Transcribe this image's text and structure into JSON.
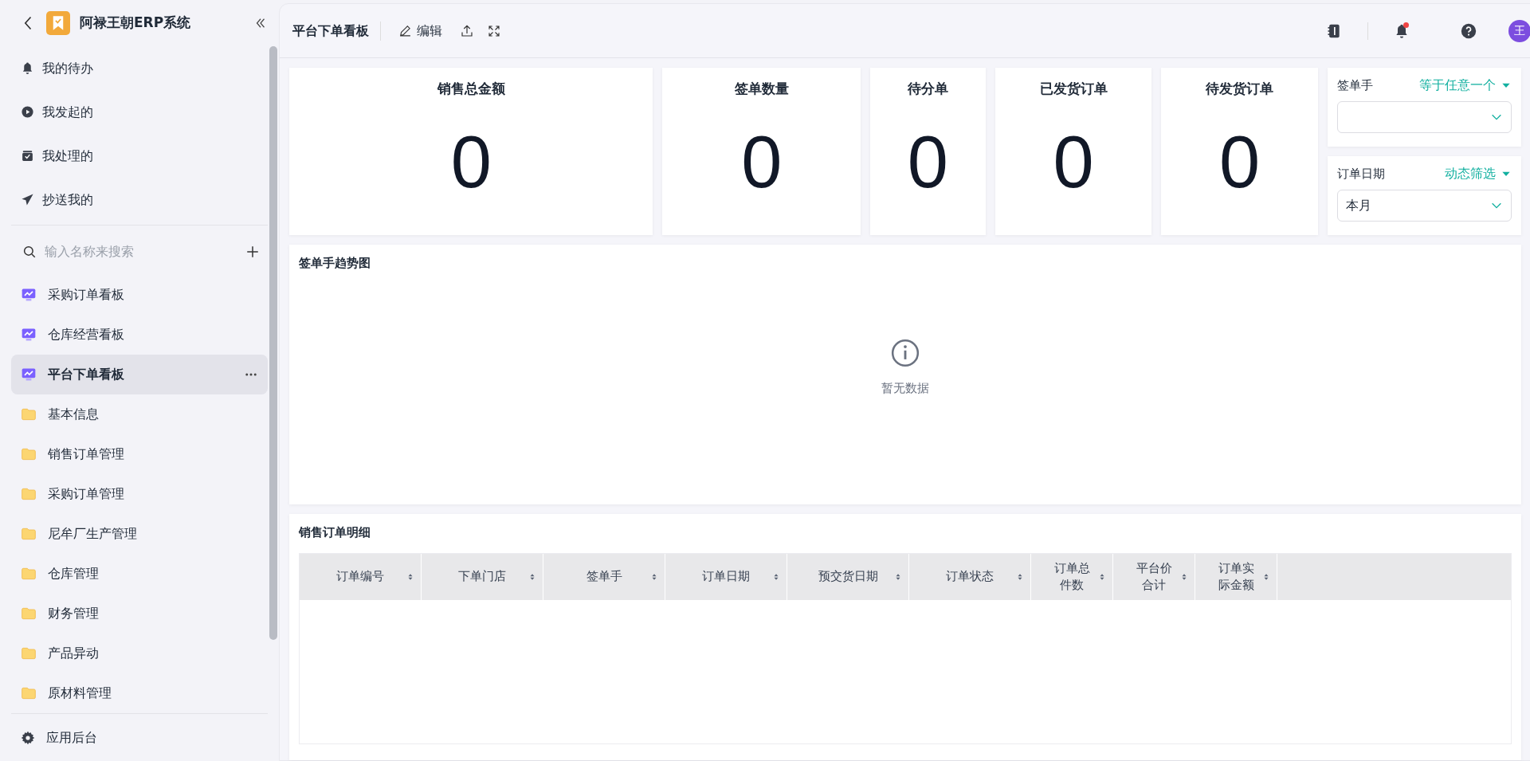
{
  "app": {
    "title": "阿禄王朝ERP系统"
  },
  "sidebar": {
    "nav": [
      {
        "label": "我的待办",
        "kind": "bell"
      },
      {
        "label": "我发起的",
        "kind": "play"
      },
      {
        "label": "我处理的",
        "kind": "inbox"
      },
      {
        "label": "抄送我的",
        "kind": "send"
      }
    ],
    "search": {
      "placeholder": "输入名称来搜索"
    },
    "items": [
      {
        "label": "采购订单看板",
        "kind": "dashboard",
        "selected": false
      },
      {
        "label": "仓库经营看板",
        "kind": "dashboard",
        "selected": false
      },
      {
        "label": "平台下单看板",
        "kind": "dashboard",
        "selected": true
      },
      {
        "label": "基本信息",
        "kind": "folder",
        "selected": false
      },
      {
        "label": "销售订单管理",
        "kind": "folder",
        "selected": false
      },
      {
        "label": "采购订单管理",
        "kind": "folder",
        "selected": false
      },
      {
        "label": "尼牟厂生产管理",
        "kind": "folder",
        "selected": false
      },
      {
        "label": "仓库管理",
        "kind": "folder",
        "selected": false
      },
      {
        "label": "财务管理",
        "kind": "folder",
        "selected": false
      },
      {
        "label": "产品异动",
        "kind": "folder",
        "selected": false
      },
      {
        "label": "原材料管理",
        "kind": "folder",
        "selected": false
      }
    ],
    "footer": {
      "label": "应用后台"
    }
  },
  "header": {
    "title": "平台下单看板",
    "edit_label": "编辑",
    "notification_dot": true,
    "avatar": "王"
  },
  "stats": [
    {
      "label": "销售总金额",
      "value": "0"
    },
    {
      "label": "签单数量",
      "value": "0"
    },
    {
      "label": "待分单",
      "value": "0"
    },
    {
      "label": "已发货订单",
      "value": "0"
    },
    {
      "label": "待发货订单",
      "value": "0"
    }
  ],
  "filters": [
    {
      "label": "签单手",
      "mode": "等于任意一个"
    },
    {
      "label": "订单日期",
      "mode": "动态筛选",
      "value": "本月"
    }
  ],
  "chart_panel": {
    "title": "签单手趋势图",
    "empty_text": "暂无数据"
  },
  "table": {
    "title": "销售订单明细",
    "columns": [
      "订单编号",
      "下单门店",
      "签单手",
      "订单日期",
      "预交货日期",
      "订单状态",
      "订单总件数",
      "平台价合计",
      "订单实际金额"
    ]
  }
}
